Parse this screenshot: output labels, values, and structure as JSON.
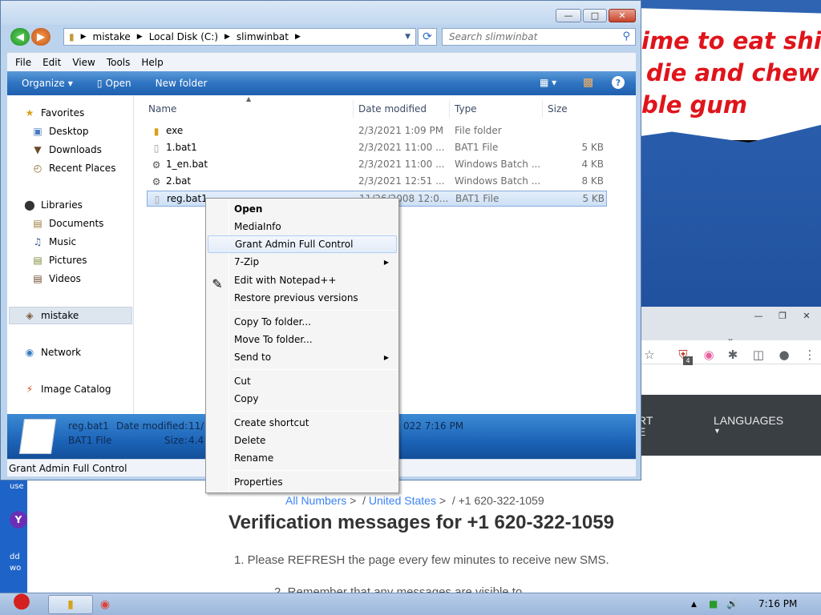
{
  "meme": {
    "line1": "ime to eat shi",
    "line2": "die and chew",
    "line3": "ble gum"
  },
  "browser": {
    "nav_items": [
      "RT",
      "E",
      "LANGUAGES"
    ],
    "crumbs": {
      "all_numbers": "All Numbers",
      "sep1": ">",
      "slash": "/",
      "country": "United States",
      "sep2": ">",
      "sep3": "/",
      "number": "+1 620-322-1059"
    },
    "title": "Verification messages for +1 620-322-1059",
    "note": "1. Please REFRESH the page every few minutes to receive new SMS.",
    "note2": "2. Remember that any messages are visible to"
  },
  "explorer": {
    "address": [
      "mistake",
      "Local Disk (C:)",
      "slimwinbat"
    ],
    "search_placeholder": "Search slimwinbat",
    "menu": [
      "File",
      "Edit",
      "View",
      "Tools",
      "Help"
    ],
    "commands": {
      "organize": "Organize",
      "open": "Open",
      "new_folder": "New folder"
    },
    "nav": {
      "favorites": "Favorites",
      "desktop": "Desktop",
      "downloads": "Downloads",
      "recent_places": "Recent Places",
      "libraries": "Libraries",
      "documents": "Documents",
      "music": "Music",
      "pictures": "Pictures",
      "videos": "Videos",
      "mistake": "mistake",
      "network": "Network",
      "image_catalog": "Image Catalog"
    },
    "columns": {
      "name": "Name",
      "date": "Date modified",
      "type": "Type",
      "size": "Size"
    },
    "files": [
      {
        "name": "exe",
        "date": "2/3/2021 1:09 PM",
        "type": "File folder",
        "size": ""
      },
      {
        "name": "1.bat1",
        "date": "2/3/2021 11:00 ...",
        "type": "BAT1 File",
        "size": "5 KB"
      },
      {
        "name": "1_en.bat",
        "date": "2/3/2021 11:00 ...",
        "type": "Windows Batch ...",
        "size": "4 KB"
      },
      {
        "name": "2.bat",
        "date": "2/3/2021 12:51 ...",
        "type": "Windows Batch ...",
        "size": "8 KB"
      },
      {
        "name": "reg.bat1",
        "date": "11/26/2008 12:0...",
        "type": "BAT1 File",
        "size": "5 KB"
      }
    ],
    "details": {
      "name": "reg.bat1",
      "date_label": "Date modified:",
      "date_value": "11/",
      "type": "BAT1 File",
      "size_label": "Size:",
      "size_value": "4.4",
      "created_tail": "022 7:16 PM"
    },
    "status": "Grant Admin Full Control"
  },
  "context_menu": {
    "open": "Open",
    "mediainfo": "MediaInfo",
    "grant": "Grant Admin Full Control",
    "zip": "7-Zip",
    "notepad": "Edit with Notepad++",
    "restore": "Restore previous versions",
    "copy_to": "Copy To folder...",
    "move_to": "Move To folder...",
    "send_to": "Send to",
    "cut": "Cut",
    "copy": "Copy",
    "shortcut": "Create shortcut",
    "delete": "Delete",
    "rename": "Rename",
    "properties": "Properties"
  },
  "desktop": {
    "label1": "use",
    "label2": "dd",
    "label3": "wo"
  },
  "taskbar": {
    "time": "7:16 PM",
    "badge": "4"
  }
}
